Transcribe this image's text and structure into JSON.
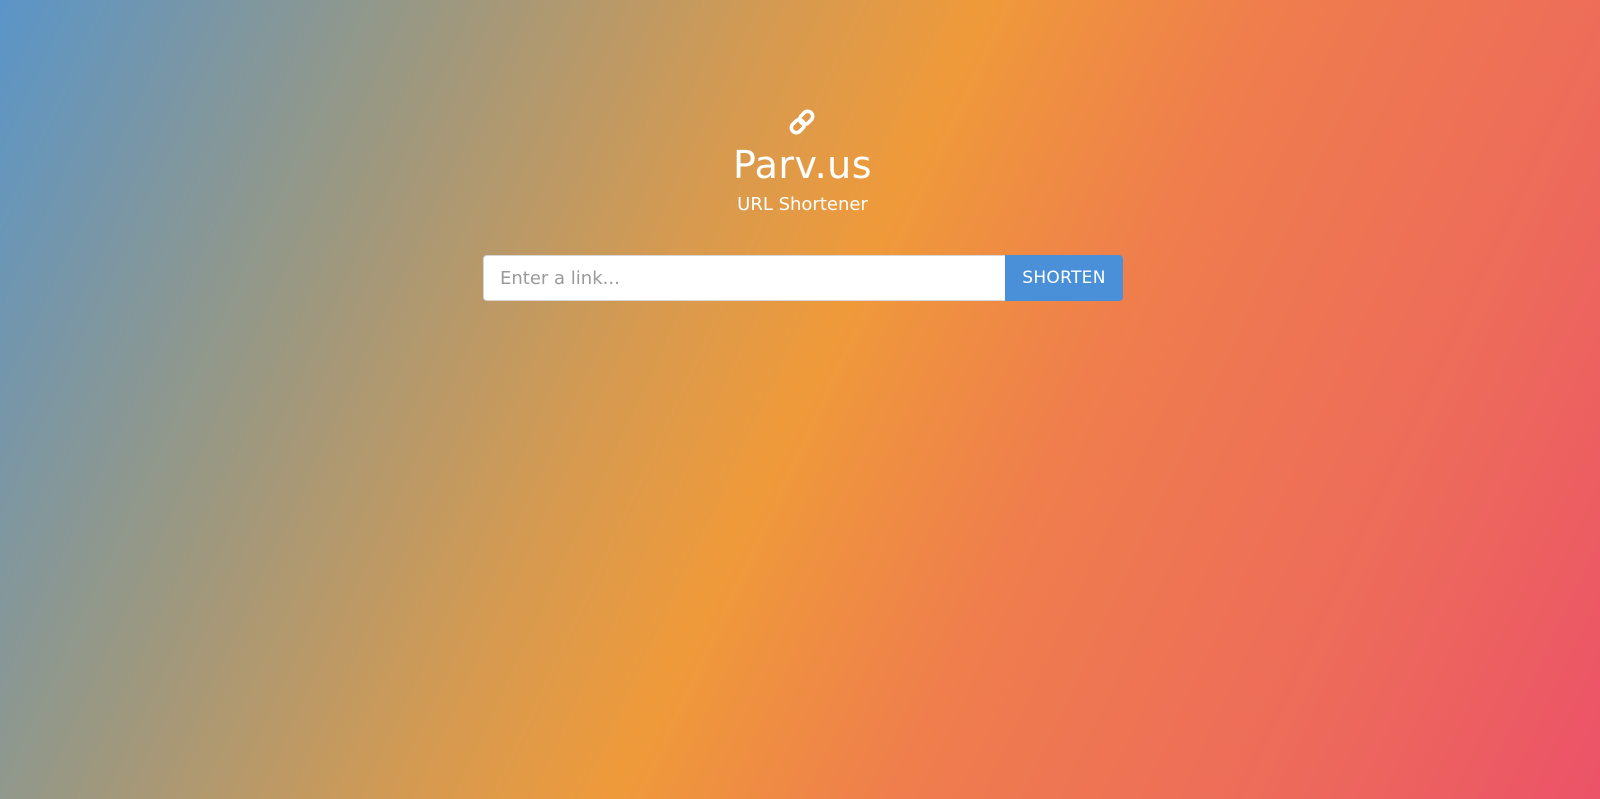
{
  "header": {
    "icon": "link-icon",
    "title": "Parv.us",
    "subtitle": "URL Shortener"
  },
  "form": {
    "input_placeholder": "Enter a link...",
    "input_value": "",
    "button_label": "SHORTEN"
  },
  "colors": {
    "gradient": [
      "#5a95c8",
      "#9a9882",
      "#d69a50",
      "#ef9a3a",
      "#ef7e4c",
      "#ed6a5b",
      "#ec5268"
    ],
    "button": "#4a90d9",
    "text": "#ffffff"
  }
}
